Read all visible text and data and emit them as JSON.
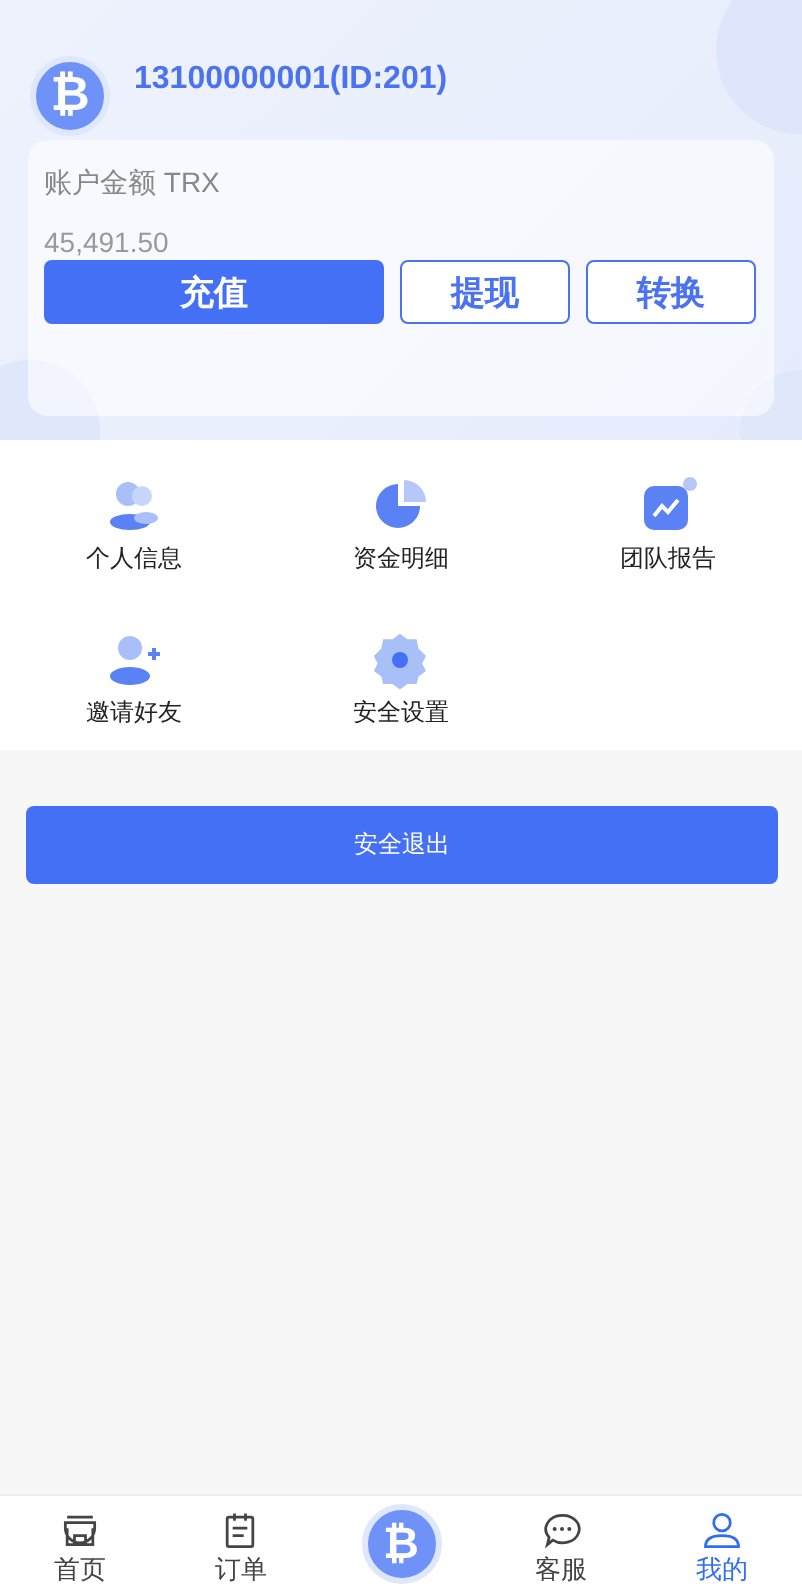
{
  "profile": {
    "coin_symbol": "₿",
    "account": "13100000001(ID:201)"
  },
  "balance": {
    "label": "账户金额 TRX",
    "amount": "45,491.50"
  },
  "actions": [
    {
      "label": "充值",
      "kind": "primary"
    },
    {
      "label": "提现",
      "kind": "outline"
    },
    {
      "label": "转换",
      "kind": "outline"
    }
  ],
  "menu": [
    {
      "label": "个人信息",
      "kind": "people"
    },
    {
      "label": "资金明细",
      "kind": "pie"
    },
    {
      "label": "团队报告",
      "kind": "chart"
    },
    {
      "label": "邀请好友",
      "kind": "invite"
    },
    {
      "label": "安全设置",
      "kind": "gear"
    }
  ],
  "logout": {
    "label": "安全退出"
  },
  "tabs": [
    {
      "label": "首页",
      "kind": "shop",
      "selected": false
    },
    {
      "label": "订单",
      "kind": "notepad",
      "selected": false
    },
    {
      "kind": "coin",
      "symbol": "₿",
      "selected": false
    },
    {
      "label": "客服",
      "kind": "chat",
      "selected": false
    },
    {
      "label": "我的",
      "kind": "user",
      "selected": true
    }
  ]
}
